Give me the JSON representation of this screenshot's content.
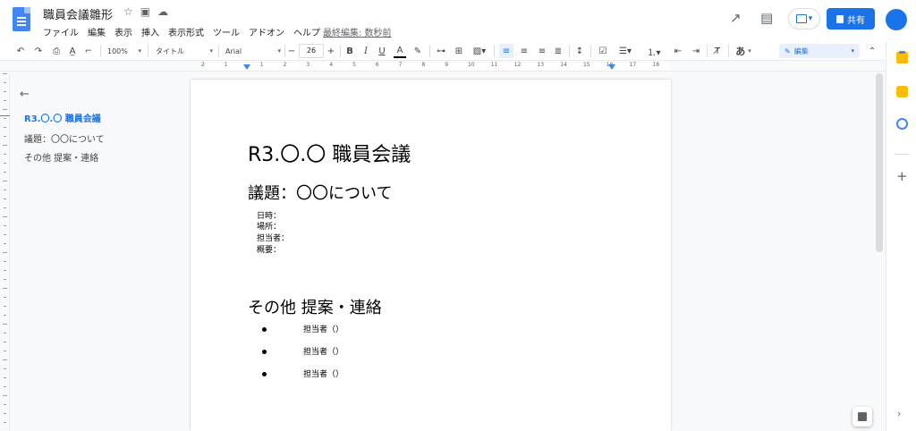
{
  "header": {
    "doc_title": "職員会議雛形",
    "menu": [
      "ファイル",
      "編集",
      "表示",
      "挿入",
      "表示形式",
      "ツール",
      "アドオン",
      "ヘルプ"
    ],
    "last_edit": "最終編集: 数秒前",
    "share_label": "共有"
  },
  "toolbar": {
    "zoom": "100%",
    "style": "タイトル",
    "font": "Arial",
    "font_size": "26",
    "input_tool": "あ",
    "mode": "編集"
  },
  "ruler": {
    "labels": [
      "2",
      "1",
      "1",
      "2",
      "3",
      "4",
      "5",
      "6",
      "7",
      "8",
      "9",
      "10",
      "11",
      "12",
      "13",
      "14",
      "15",
      "16",
      "17",
      "18"
    ]
  },
  "outline": {
    "items": [
      "R3.〇.〇 職員会議",
      "議題：〇〇について",
      "その他 提案・連絡"
    ]
  },
  "document": {
    "title": "R3.〇.〇 職員会議",
    "heading1": "議題：〇〇について",
    "fields": [
      "日時：",
      "場所：",
      "担当者：",
      "概要："
    ],
    "heading2": "その他 提案・連絡",
    "bullets": [
      "担当者（）",
      "担当者（）",
      "担当者（）"
    ]
  },
  "colors": {
    "accent": "#1a73e8",
    "docs_blue": "#4285f4"
  }
}
